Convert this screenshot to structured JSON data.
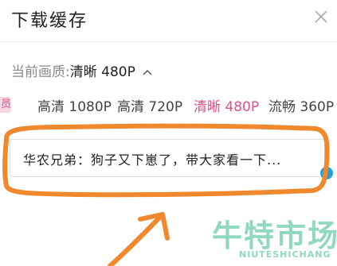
{
  "header": {
    "title": "下载缓存",
    "close_icon": "close-icon"
  },
  "quality": {
    "prefix": "当前画质:",
    "current": "清晰 480P",
    "chevron_icon": "chevron-up-icon"
  },
  "options": {
    "vip_badge": "员",
    "items": [
      {
        "label": "高清 1080P",
        "active": false
      },
      {
        "label": "高清 720P",
        "active": false
      },
      {
        "label": "清晰 480P",
        "active": true
      },
      {
        "label": "流畅 360P",
        "active": false
      }
    ]
  },
  "video": {
    "title": "华农兄弟：狗子又下崽了，带大家看一下..."
  },
  "colors": {
    "accent": "#e0508a",
    "annotation": "#f0882e",
    "watermark": "#37b98b",
    "side_dot": "#1ea3e0"
  },
  "watermark": {
    "chinese": "牛特市场",
    "english": "NIUTESHICHANG"
  }
}
